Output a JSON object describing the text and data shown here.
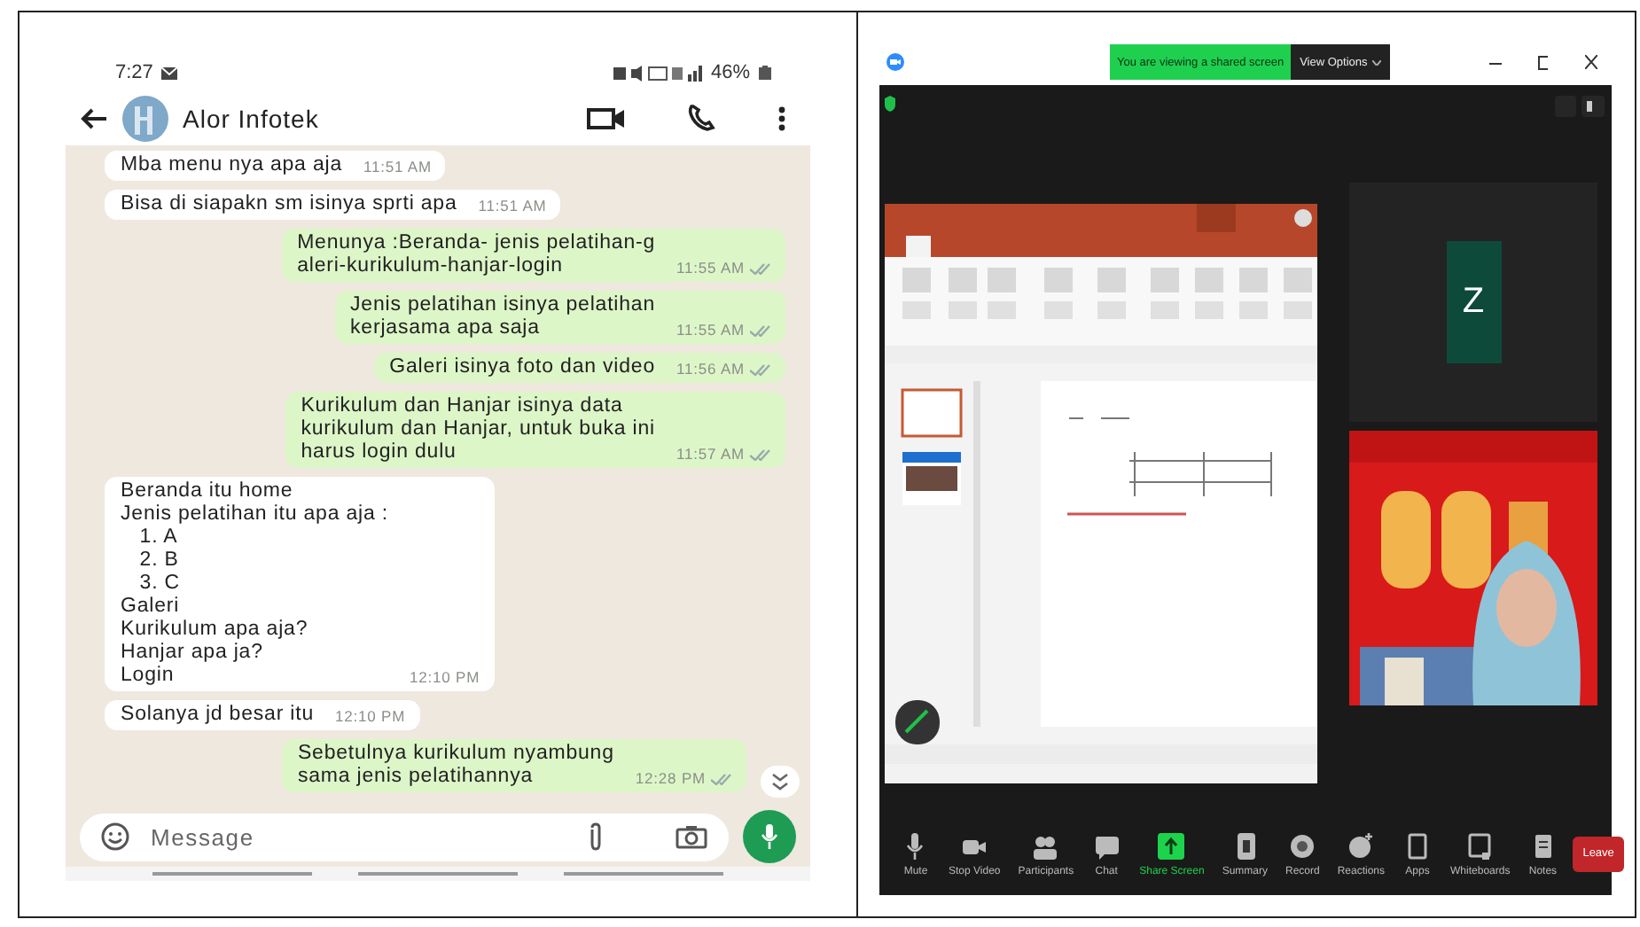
{
  "phone": {
    "status_bar": {
      "time": "7:27",
      "battery": "46%"
    },
    "chat_header": {
      "contact": "Alor Infotek"
    },
    "messages": [
      {
        "kind": "incoming",
        "text": "Mba menu nya apa aja",
        "time": "11:51 AM"
      },
      {
        "kind": "incoming",
        "text": "Bisa di siapakn sm isinya sprti apa",
        "time": "11:51 AM"
      },
      {
        "kind": "outgoing",
        "text": "Menunya :Beranda- jenis pelatihan-g\naleri-kurikulum-hanjar-login",
        "time": "11:55 AM"
      },
      {
        "kind": "outgoing",
        "text": "Jenis pelatihan isinya pelatihan\nkerjasama apa saja",
        "time": "11:55 AM"
      },
      {
        "kind": "outgoing",
        "text": "Galeri isinya foto dan video",
        "time": "11:56 AM"
      },
      {
        "kind": "outgoing",
        "text": "Kurikulum dan Hanjar isinya data\nkurikulum dan Hanjar, untuk buka ini\nharus login dulu",
        "time": "11:57 AM"
      },
      {
        "kind": "incoming",
        "text": "Beranda itu home\nJenis pelatihan itu apa aja :\n   1. A\n   2. B\n   3. C\nGaleri\nKurikulum apa aja?\nHanjar apa ja?\nLogin",
        "time": "12:10 PM"
      },
      {
        "kind": "incoming",
        "text": "Solanya jd besar itu",
        "time": "12:10 PM"
      },
      {
        "kind": "outgoing",
        "text": "Sebetulnya kurikulum nyambung\nsama jenis pelatihannya",
        "time": "12:28 PM"
      }
    ],
    "composer": {
      "placeholder": "Message"
    }
  },
  "zoom": {
    "banner": {
      "text": "You are viewing a shared screen",
      "button": "View Options"
    },
    "participant_tile": {
      "initial": "Z"
    },
    "toolbar": [
      {
        "kind": "mic",
        "label": "Mute",
        "active": false
      },
      {
        "kind": "video",
        "label": "Stop Video",
        "active": false
      },
      {
        "kind": "participants",
        "label": "Participants",
        "active": false
      },
      {
        "kind": "chat",
        "label": "Chat",
        "active": false
      },
      {
        "kind": "share",
        "label": "Share Screen",
        "active": true
      },
      {
        "kind": "summary",
        "label": "Summary",
        "active": false
      },
      {
        "kind": "record",
        "label": "Record",
        "active": false
      },
      {
        "kind": "reactions",
        "label": "Reactions",
        "active": false
      },
      {
        "kind": "apps",
        "label": "Apps",
        "active": false
      },
      {
        "kind": "whiteboard",
        "label": "Whiteboards",
        "active": false
      },
      {
        "kind": "notes",
        "label": "Notes",
        "active": false
      }
    ],
    "leave_button": "Leave"
  }
}
